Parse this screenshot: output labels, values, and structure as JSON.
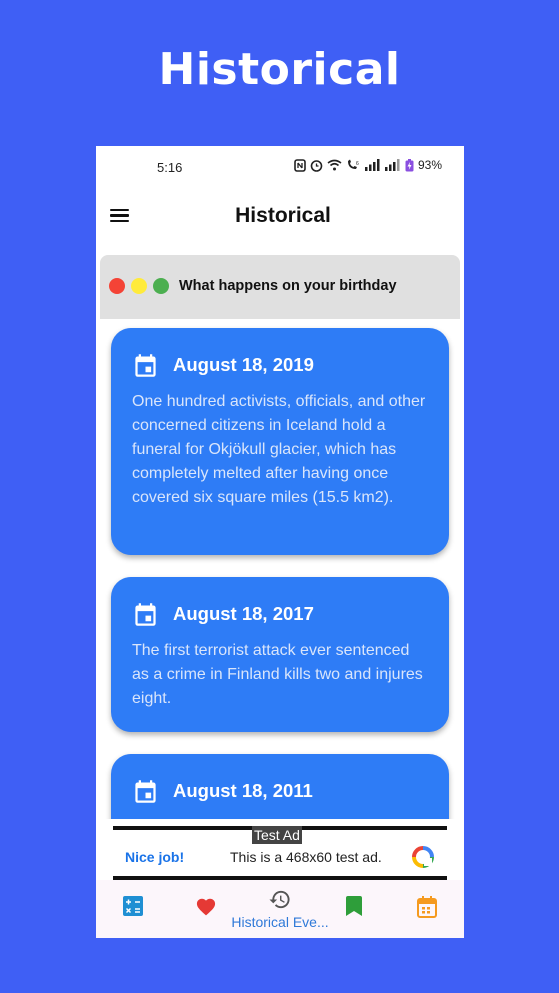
{
  "promo": {
    "title": "Historical"
  },
  "status_bar": {
    "time": "5:16",
    "battery": "93%"
  },
  "app_bar": {
    "title": "Historical"
  },
  "banner": {
    "text": "What happens on your birthday"
  },
  "events": [
    {
      "date": "August 18, 2019",
      "text": "One hundred activists, officials, and other concerned citizens in Iceland hold a funeral for Okjökull glacier, which has completely melted after having once covered six square miles (15.5 km2)."
    },
    {
      "date": "August 18, 2017",
      "text": "The first terrorist attack ever sentenced as a crime in Finland kills two and injures eight."
    },
    {
      "date": "August 18, 2011",
      "text": ""
    }
  ],
  "ad": {
    "label": "Test Ad",
    "nice": "Nice job!",
    "text": "This is a 468x60 test ad."
  },
  "bottom_nav": {
    "items": [
      {
        "icon": "calculator-icon",
        "color": "#1f8fd3"
      },
      {
        "icon": "heart-icon",
        "color": "#e53935"
      },
      {
        "icon": "history-icon",
        "label": "Historical Eve...",
        "color": "#555555"
      },
      {
        "icon": "bookmark-icon",
        "color": "#2e9e3a"
      },
      {
        "icon": "calendar-icon",
        "color": "#f59a1f"
      }
    ]
  },
  "colors": {
    "background": "#3f5ff5",
    "card": "#2e7cf6",
    "banner": "#e0e0e0"
  }
}
